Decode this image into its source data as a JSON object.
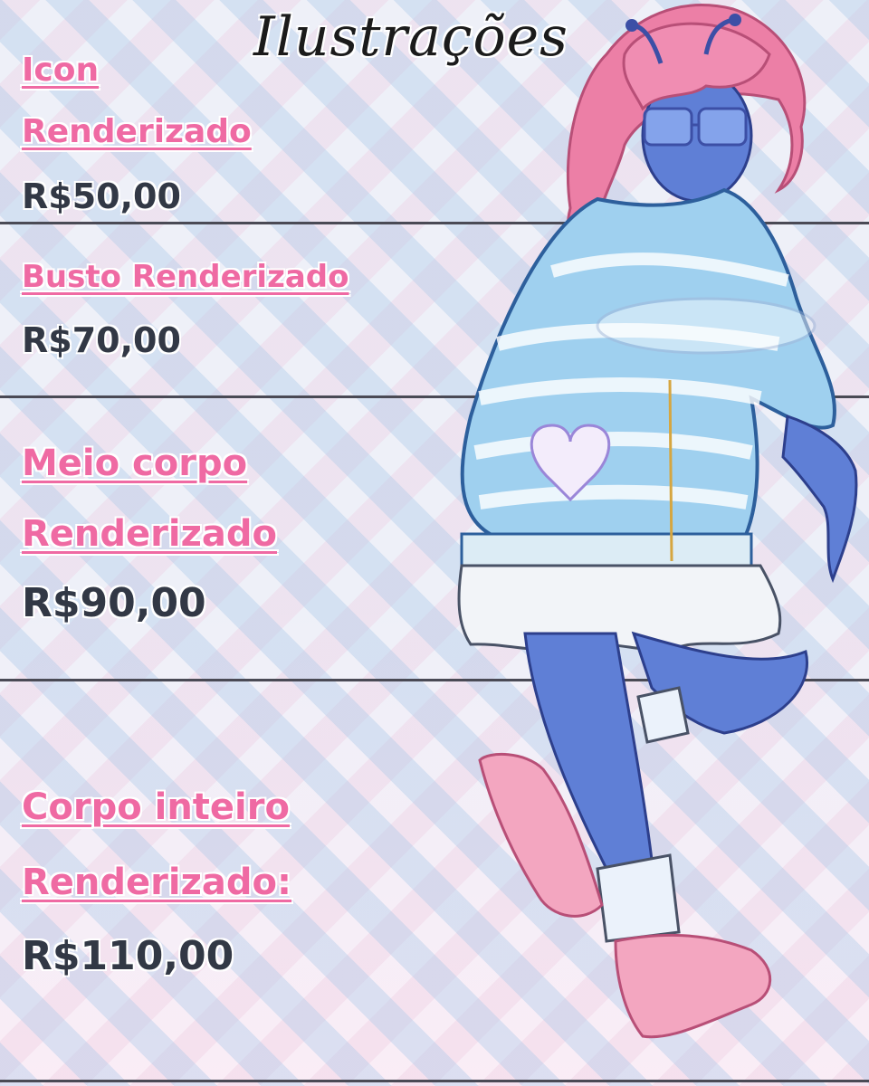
{
  "title": "Ilustrações",
  "tiers": [
    {
      "line1": "Icon",
      "line2": "Renderizado",
      "price": "R$50,00"
    },
    {
      "line1": "Busto Renderizado",
      "price": "R$70,00"
    },
    {
      "line1": "Meio corpo",
      "line2": "Renderizado",
      "price": "R$90,00"
    },
    {
      "line1": "Corpo inteiro",
      "line2": "Renderizado:",
      "price": "R$110,00"
    }
  ],
  "colors": {
    "label": "#ef6aa3",
    "price": "#323845",
    "divider": "#4a4a55"
  },
  "illustration": {
    "subject": "character-illustration",
    "watermark": "watermark"
  }
}
